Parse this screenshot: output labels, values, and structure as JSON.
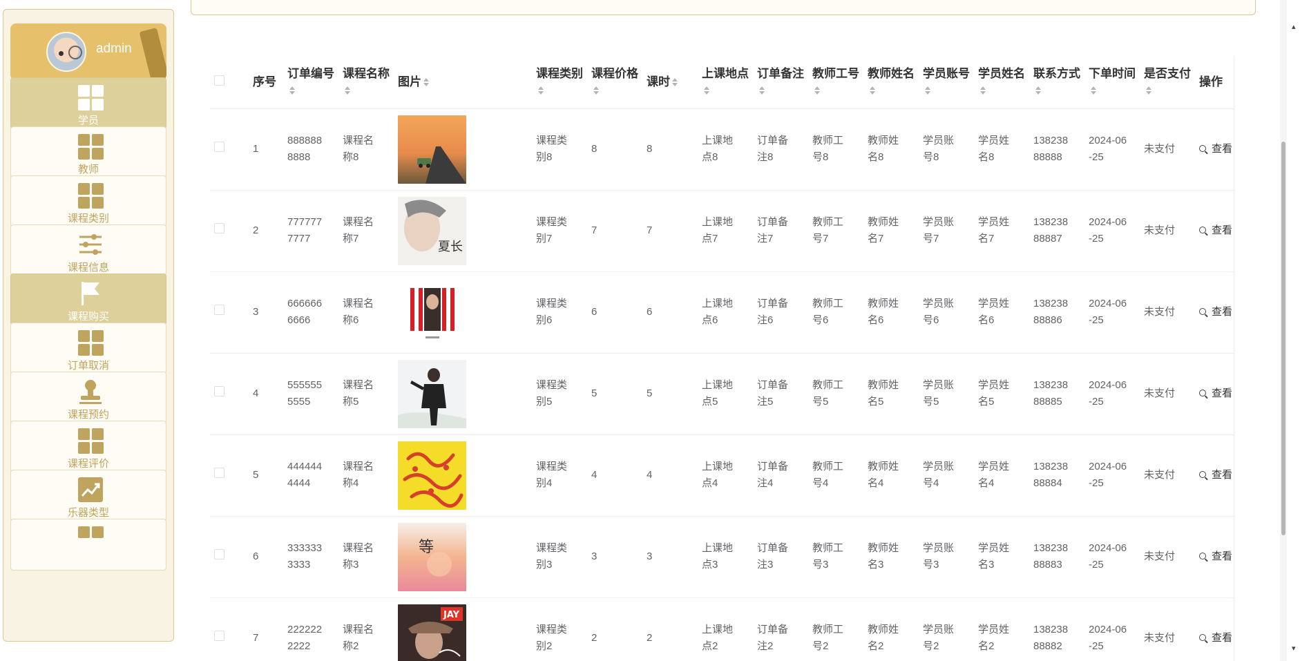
{
  "user": {
    "name": "admin"
  },
  "nav": [
    {
      "label": "学员",
      "icon": "grid-icon",
      "active": true
    },
    {
      "label": "教师",
      "icon": "grid-icon",
      "active": false
    },
    {
      "label": "课程类别",
      "icon": "grid-icon",
      "active": false
    },
    {
      "label": "课程信息",
      "icon": "sliders-icon",
      "active": false
    },
    {
      "label": "课程购买",
      "icon": "flag-icon",
      "active": true
    },
    {
      "label": "订单取消",
      "icon": "grid-icon",
      "active": false
    },
    {
      "label": "课程预约",
      "icon": "stamp-icon",
      "active": false
    },
    {
      "label": "课程评价",
      "icon": "grid-icon",
      "active": false
    },
    {
      "label": "乐器类型",
      "icon": "trend-chart-icon",
      "active": false
    }
  ],
  "table": {
    "headers": {
      "index": "序号",
      "order_no": "订单编号",
      "course_name": "课程名称",
      "image": "图片",
      "category": "课程类别",
      "price": "课程价格",
      "hours": "课时",
      "location": "上课地点",
      "remark": "订单备注",
      "teacher_id": "教师工号",
      "teacher_name": "教师姓名",
      "student_acct": "学员账号",
      "student_name": "学员姓名",
      "phone": "联系方式",
      "order_time": "下单时间",
      "paid": "是否支付",
      "actions": "操作"
    },
    "rows": [
      {
        "index": "1",
        "order_no_a": "888888",
        "order_no_b": "8888",
        "course_a": "课程名",
        "course_b": "称8",
        "cat_a": "课程类",
        "cat_b": "别8",
        "price": "8",
        "hours": "8",
        "loc_a": "上课地",
        "loc_b": "点8",
        "rem_a": "订单备",
        "rem_b": "注8",
        "tid_a": "教师工",
        "tid_b": "号8",
        "tname_a": "教师姓",
        "tname_b": "名8",
        "sacct_a": "学员账",
        "sacct_b": "号8",
        "sname_a": "学员姓",
        "sname_b": "名8",
        "phone_a": "138238",
        "phone_b": "88888",
        "time_a": "2024-06",
        "time_b": "-25",
        "paid": "未支付",
        "action": "查看",
        "image_style": "sunset"
      },
      {
        "index": "2",
        "order_no_a": "777777",
        "order_no_b": "7777",
        "course_a": "课程名",
        "course_b": "称7",
        "cat_a": "课程类",
        "cat_b": "别7",
        "price": "7",
        "hours": "7",
        "loc_a": "上课地",
        "loc_b": "点7",
        "rem_a": "订单备",
        "rem_b": "注7",
        "tid_a": "教师工",
        "tid_b": "号7",
        "tname_a": "教师姓",
        "tname_b": "名7",
        "sacct_a": "学员账",
        "sacct_b": "号7",
        "sname_a": "学员姓",
        "sname_b": "名7",
        "phone_a": "138238",
        "phone_b": "88887",
        "time_a": "2024-06",
        "time_b": "-25",
        "paid": "未支付",
        "action": "查看",
        "image_style": "portrait"
      },
      {
        "index": "3",
        "order_no_a": "666666",
        "order_no_b": "6666",
        "course_a": "课程名",
        "course_b": "称6",
        "cat_a": "课程类",
        "cat_b": "别6",
        "price": "6",
        "hours": "6",
        "loc_a": "上课地",
        "loc_b": "点6",
        "rem_a": "订单备",
        "rem_b": "注6",
        "tid_a": "教师工",
        "tid_b": "号6",
        "tname_a": "教师姓",
        "tname_b": "名6",
        "sacct_a": "学员账",
        "sacct_b": "号6",
        "sname_a": "学员姓",
        "sname_b": "名6",
        "phone_a": "138238",
        "phone_b": "88886",
        "time_a": "2024-06",
        "time_b": "-25",
        "paid": "未支付",
        "action": "查看",
        "image_style": "stripes"
      },
      {
        "index": "4",
        "order_no_a": "555555",
        "order_no_b": "5555",
        "course_a": "课程名",
        "course_b": "称5",
        "cat_a": "课程类",
        "cat_b": "别5",
        "price": "5",
        "hours": "5",
        "loc_a": "上课地",
        "loc_b": "点5",
        "rem_a": "订单备",
        "rem_b": "注5",
        "tid_a": "教师工",
        "tid_b": "号5",
        "tname_a": "教师姓",
        "tname_b": "名5",
        "sacct_a": "学员账",
        "sacct_b": "号5",
        "sname_a": "学员姓",
        "sname_b": "名5",
        "phone_a": "138238",
        "phone_b": "88885",
        "time_a": "2024-06",
        "time_b": "-25",
        "paid": "未支付",
        "action": "查看",
        "image_style": "suit"
      },
      {
        "index": "5",
        "order_no_a": "444444",
        "order_no_b": "4444",
        "course_a": "课程名",
        "course_b": "称4",
        "cat_a": "课程类",
        "cat_b": "别4",
        "price": "4",
        "hours": "4",
        "loc_a": "上课地",
        "loc_b": "点4",
        "rem_a": "订单备",
        "rem_b": "注4",
        "tid_a": "教师工",
        "tid_b": "号4",
        "tname_a": "教师姓",
        "tname_b": "名4",
        "sacct_a": "学员账",
        "sacct_b": "号4",
        "sname_a": "学员姓",
        "sname_b": "名4",
        "phone_a": "138238",
        "phone_b": "88884",
        "time_a": "2024-06",
        "time_b": "-25",
        "paid": "未支付",
        "action": "查看",
        "image_style": "yellow"
      },
      {
        "index": "6",
        "order_no_a": "333333",
        "order_no_b": "3333",
        "course_a": "课程名",
        "course_b": "称3",
        "cat_a": "课程类",
        "cat_b": "别3",
        "price": "3",
        "hours": "3",
        "loc_a": "上课地",
        "loc_b": "点3",
        "rem_a": "订单备",
        "rem_b": "注3",
        "tid_a": "教师工",
        "tid_b": "号3",
        "tname_a": "教师姓",
        "tname_b": "名3",
        "sacct_a": "学员账",
        "sacct_b": "号3",
        "sname_a": "学员姓",
        "sname_b": "名3",
        "phone_a": "138238",
        "phone_b": "88883",
        "time_a": "2024-06",
        "time_b": "-25",
        "paid": "未支付",
        "action": "查看",
        "image_style": "pastel"
      },
      {
        "index": "7",
        "order_no_a": "222222",
        "order_no_b": "2222",
        "course_a": "课程名",
        "course_b": "称2",
        "cat_a": "课程类",
        "cat_b": "别2",
        "price": "2",
        "hours": "2",
        "loc_a": "上课地",
        "loc_b": "点2",
        "rem_a": "订单备",
        "rem_b": "注2",
        "tid_a": "教师工",
        "tid_b": "号2",
        "tname_a": "教师姓",
        "tname_b": "名2",
        "sacct_a": "学员账",
        "sacct_b": "号2",
        "sname_a": "学员姓",
        "sname_b": "名2",
        "phone_a": "138238",
        "phone_b": "88882",
        "time_a": "2024-06",
        "time_b": "-25",
        "paid": "未支付",
        "action": "查看",
        "image_style": "jay"
      }
    ]
  },
  "colors": {
    "accent": "#e6c06a",
    "sidebar_bg": "#f8f3e3",
    "nav_active": "#ddd09a",
    "nav_label": "#c1a35c"
  }
}
